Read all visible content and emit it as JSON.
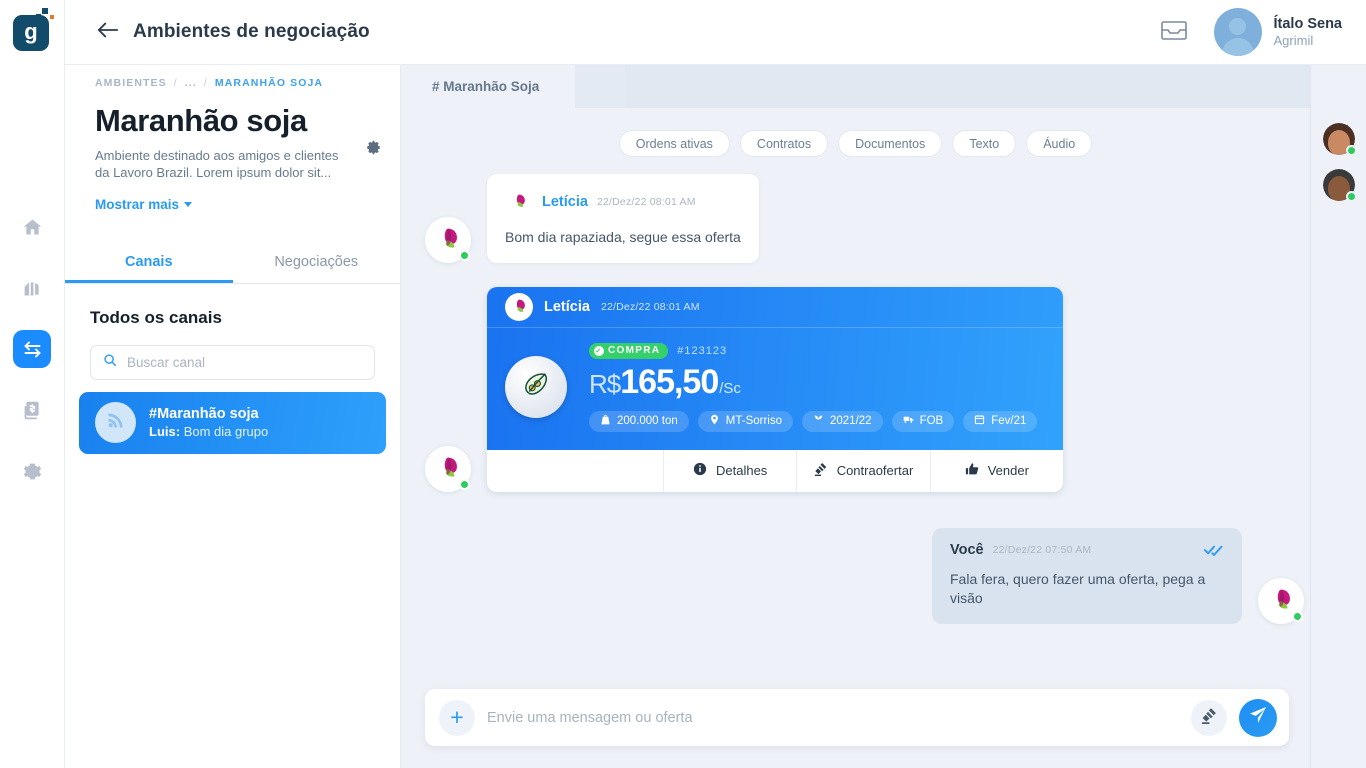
{
  "brand": {
    "logo_letter": "g",
    "accent": "#2a9bf0",
    "dark": "#134b6b"
  },
  "rail": {
    "items": [
      {
        "name": "home",
        "icon": "home-icon",
        "active": false
      },
      {
        "name": "silo",
        "icon": "silo-icon",
        "active": false
      },
      {
        "name": "negotiation",
        "icon": "exchange-arrows-icon",
        "active": true
      },
      {
        "name": "documents",
        "icon": "invoice-icon",
        "active": false
      },
      {
        "name": "settings",
        "icon": "gear-icon",
        "active": false
      }
    ]
  },
  "topbar": {
    "back_label": "back-arrow",
    "title": "Ambientes de negociação",
    "inbox_icon": "inbox-icon",
    "user": {
      "name": "Ítalo Sena",
      "org": "Agrimil"
    }
  },
  "left_panel": {
    "breadcrumb": {
      "root": "AMBIENTES",
      "ellipsis": "...",
      "current": "MARANHÃO SOJA",
      "separator": "/"
    },
    "settings_icon": "gear-icon",
    "title": "Maranhão soja",
    "description": "Ambiente destinado aos amigos e clientes da Lavoro Brazil. Lorem ipsum dolor sit...",
    "show_more": "Mostrar mais",
    "tabs": [
      {
        "label": "Canais",
        "active": true
      },
      {
        "label": "Negociações",
        "active": false
      }
    ],
    "section_title": "Todos os canais",
    "search": {
      "placeholder": "Buscar canal",
      "value": ""
    },
    "channels": [
      {
        "name": "#Maranhão soja",
        "last_sender": "Luis:",
        "last_message": "Bom dia grupo",
        "active": true
      }
    ]
  },
  "chat": {
    "tab": "# Maranhão Soja",
    "filters": [
      "Ordens ativas",
      "Contratos",
      "Documentos",
      "Texto",
      "Áudio"
    ],
    "messages": [
      {
        "type": "text",
        "direction": "in",
        "sender": "Letícia",
        "time": "22/Dez/22 08:01 AM",
        "text": "Bom dia rapaziada, segue essa oferta"
      },
      {
        "type": "offer",
        "direction": "in",
        "sender": "Letícia",
        "time": "22/Dez/22 08:01 AM",
        "badge": "COMPRA",
        "order_id": "#123123",
        "currency": "R$",
        "price": "165,50",
        "unit": "/Sc",
        "tags": [
          {
            "icon": "weight-icon",
            "label": "200.000 ton"
          },
          {
            "icon": "location-icon",
            "label": "MT-Sorriso"
          },
          {
            "icon": "harvest-icon",
            "label": "2021/22"
          },
          {
            "icon": "truck-icon",
            "label": "FOB"
          },
          {
            "icon": "calendar-icon",
            "label": "Fev/21"
          }
        ],
        "actions": [
          {
            "icon": "info-icon",
            "label": "Detalhes"
          },
          {
            "icon": "gavel-icon",
            "label": "Contraofertar"
          },
          {
            "icon": "thumbs-up-icon",
            "label": "Vender"
          }
        ]
      },
      {
        "type": "text",
        "direction": "out",
        "sender": "Você",
        "time": "22/Dez/22 07:50 AM",
        "text": "Fala fera, quero fazer uma oferta, pega a visão",
        "read_receipt": "double-check-icon"
      }
    ],
    "composer": {
      "placeholder": "Envie uma mensagem ou oferta",
      "value": "",
      "add_icon": "plus-icon",
      "offer_icon": "gavel-icon",
      "send_icon": "send-icon"
    }
  },
  "members_panel": {
    "collapse_icon": "collapse-left-icon",
    "members": [
      {
        "status": "online",
        "hair": "#4a2f22",
        "skin": "#c98a63"
      },
      {
        "status": "online",
        "hair": "#3a3a3a",
        "skin": "#8a5a3c"
      }
    ]
  }
}
